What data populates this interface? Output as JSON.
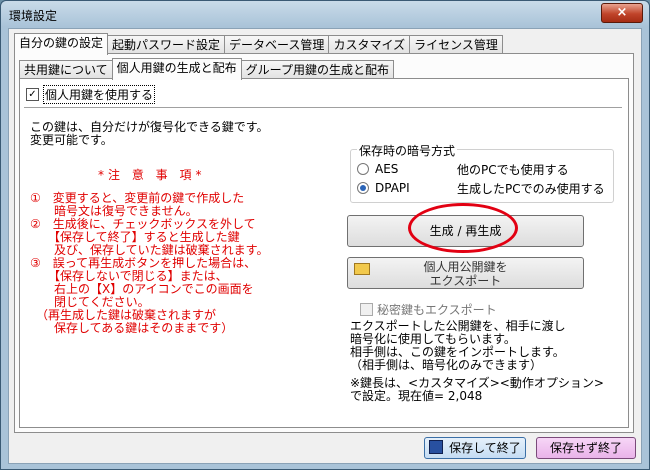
{
  "window": {
    "title": "環境設定",
    "close_glyph": "×"
  },
  "tabs": [
    "自分の鍵の設定",
    "起動パスワード設定",
    "データベース管理",
    "カスタマイズ",
    "ライセンス管理"
  ],
  "subtabs": [
    "共用鍵について",
    "個人用鍵の生成と配布",
    "グループ用鍵の生成と配布"
  ],
  "use_key": {
    "label": "個人用鍵を使用する",
    "checked": true,
    "check_glyph": "✓"
  },
  "description": "この鍵は、自分だけが復号化できる鍵です。\n変更可能です。",
  "caution_title": "*注 意 事 項*",
  "caution_text": "①　変更すると、変更前の鍵で作成した\n　　暗号文は復号できません。\n②　生成後に、チェックボックスを外して\n　　【保存して終了】すると生成した鍵\n　　及び、保存していた鍵は破棄されます。\n③　誤って再生成ボタンを押した場合は、\n　　【保存しないで閉じる】または、\n　　右上の【X】のアイコンでこの画面を\n　　閉じてください。\n　（再生成した鍵は破棄されますが\n　　保存してある鍵はそのままです）",
  "encryption_group": {
    "title": "保存時の暗号方式",
    "options": [
      {
        "label": "AES",
        "note": "他のPCでも使用する",
        "selected": false
      },
      {
        "label": "DPAPI",
        "note": "生成したPCでのみ使用する",
        "selected": true
      }
    ]
  },
  "generate_button": "生成 / 再生成",
  "export_button": {
    "line1": "個人用公開鍵を",
    "line2": "エクスポート"
  },
  "export_secret": {
    "label": "秘密鍵もエクスポート",
    "checked": false
  },
  "export_note": "エクスポートした公開鍵を、相手に渡し\n暗号化に使用してもらいます。\n相手側は、この鍵をインポートします。\n（相手側は、暗号化のみできます）",
  "key_length_note": "※鍵長は、<カスタマイズ><動作オプション>\nで設定。現在値= 2,048",
  "footer": {
    "save_button": "保存して終了",
    "no_save_button": "保存せず終了"
  }
}
